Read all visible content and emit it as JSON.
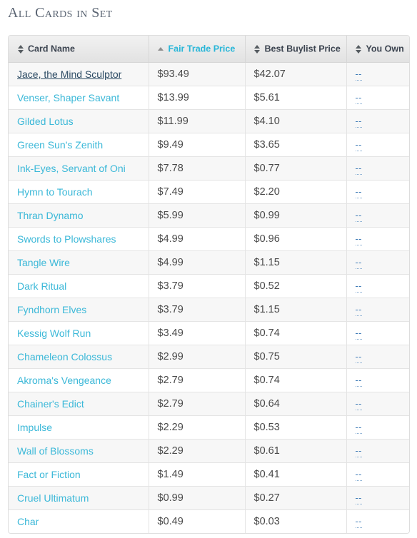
{
  "page": {
    "title": "All Cards in Set"
  },
  "table": {
    "columns": [
      {
        "key": "card_name",
        "label": "Card Name",
        "sort_icon": "sort-both-icon",
        "sorted": false,
        "direction": "none"
      },
      {
        "key": "fair_trade",
        "label": "Fair Trade Price",
        "sort_icon": "sort-asc-icon",
        "sorted": true,
        "direction": "asc"
      },
      {
        "key": "best_buylist",
        "label": "Best Buylist Price",
        "sort_icon": "sort-both-icon",
        "sorted": false,
        "direction": "none"
      },
      {
        "key": "you_own",
        "label": "You Own",
        "sort_icon": "sort-both-icon",
        "sorted": false,
        "direction": "none"
      }
    ],
    "rows": [
      {
        "card_name": "Jace, the Mind Sculptor",
        "fair_trade": "$93.49",
        "best_buylist": "$42.07",
        "you_own": "--",
        "hovered": true
      },
      {
        "card_name": "Venser, Shaper Savant",
        "fair_trade": "$13.99",
        "best_buylist": "$5.61",
        "you_own": "--",
        "hovered": false
      },
      {
        "card_name": "Gilded Lotus",
        "fair_trade": "$11.99",
        "best_buylist": "$4.10",
        "you_own": "--",
        "hovered": false
      },
      {
        "card_name": "Green Sun's Zenith",
        "fair_trade": "$9.49",
        "best_buylist": "$3.65",
        "you_own": "--",
        "hovered": false
      },
      {
        "card_name": "Ink-Eyes, Servant of Oni",
        "fair_trade": "$7.78",
        "best_buylist": "$0.77",
        "you_own": "--",
        "hovered": false
      },
      {
        "card_name": "Hymn to Tourach",
        "fair_trade": "$7.49",
        "best_buylist": "$2.20",
        "you_own": "--",
        "hovered": false
      },
      {
        "card_name": "Thran Dynamo",
        "fair_trade": "$5.99",
        "best_buylist": "$0.99",
        "you_own": "--",
        "hovered": false
      },
      {
        "card_name": "Swords to Plowshares",
        "fair_trade": "$4.99",
        "best_buylist": "$0.96",
        "you_own": "--",
        "hovered": false
      },
      {
        "card_name": "Tangle Wire",
        "fair_trade": "$4.99",
        "best_buylist": "$1.15",
        "you_own": "--",
        "hovered": false
      },
      {
        "card_name": "Dark Ritual",
        "fair_trade": "$3.79",
        "best_buylist": "$0.52",
        "you_own": "--",
        "hovered": false
      },
      {
        "card_name": "Fyndhorn Elves",
        "fair_trade": "$3.79",
        "best_buylist": "$1.15",
        "you_own": "--",
        "hovered": false
      },
      {
        "card_name": "Kessig Wolf Run",
        "fair_trade": "$3.49",
        "best_buylist": "$0.74",
        "you_own": "--",
        "hovered": false
      },
      {
        "card_name": "Chameleon Colossus",
        "fair_trade": "$2.99",
        "best_buylist": "$0.75",
        "you_own": "--",
        "hovered": false
      },
      {
        "card_name": "Akroma's Vengeance",
        "fair_trade": "$2.79",
        "best_buylist": "$0.74",
        "you_own": "--",
        "hovered": false
      },
      {
        "card_name": "Chainer's Edict",
        "fair_trade": "$2.79",
        "best_buylist": "$0.64",
        "you_own": "--",
        "hovered": false
      },
      {
        "card_name": "Impulse",
        "fair_trade": "$2.29",
        "best_buylist": "$0.53",
        "you_own": "--",
        "hovered": false
      },
      {
        "card_name": "Wall of Blossoms",
        "fair_trade": "$2.29",
        "best_buylist": "$0.61",
        "you_own": "--",
        "hovered": false
      },
      {
        "card_name": "Fact or Fiction",
        "fair_trade": "$1.49",
        "best_buylist": "$0.41",
        "you_own": "--",
        "hovered": false
      },
      {
        "card_name": "Cruel Ultimatum",
        "fair_trade": "$0.99",
        "best_buylist": "$0.27",
        "you_own": "--",
        "hovered": false
      },
      {
        "card_name": "Char",
        "fair_trade": "$0.49",
        "best_buylist": "$0.03",
        "you_own": "--",
        "hovered": false
      }
    ]
  },
  "colors": {
    "title": "#5a6472",
    "link": "#3bb8d8",
    "link_hover": "#2b4a63",
    "sorted_header": "#29b6d8",
    "header_text": "#3c4450",
    "own_link": "#3a78b5",
    "row_odd": "#f7f7f7",
    "row_even": "#ffffff",
    "border": "#e4e4e4"
  }
}
